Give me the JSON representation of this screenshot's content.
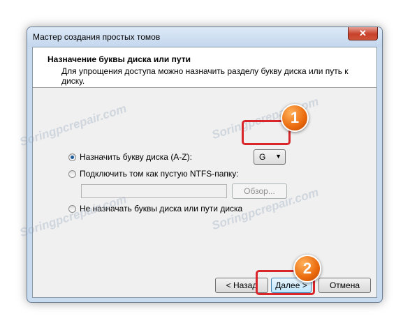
{
  "window": {
    "title": "Мастер создания простых томов",
    "close_glyph": "✕"
  },
  "header": {
    "title": "Назначение буквы диска или пути",
    "description": "Для упрощения доступа можно назначить разделу букву диска или путь к диску."
  },
  "options": {
    "assign_letter": {
      "label": "Назначить букву диска (A-Z):",
      "selected": true
    },
    "mount_folder": {
      "label": "Подключить том как пустую NTFS-папку:",
      "selected": false
    },
    "no_assign": {
      "label": "Не назначать буквы диска или пути диска",
      "selected": false
    }
  },
  "drive_letter": {
    "value": "G"
  },
  "path_input": {
    "value": ""
  },
  "buttons": {
    "browse": "Обзор...",
    "back": "< Назад",
    "next": "Далее >",
    "cancel": "Отмена"
  },
  "annotations": {
    "badge1": "1",
    "badge2": "2"
  },
  "watermark": "Soringpcrepair.com",
  "colors": {
    "highlight": "#d9262b",
    "badge": "#ea6a0c"
  }
}
